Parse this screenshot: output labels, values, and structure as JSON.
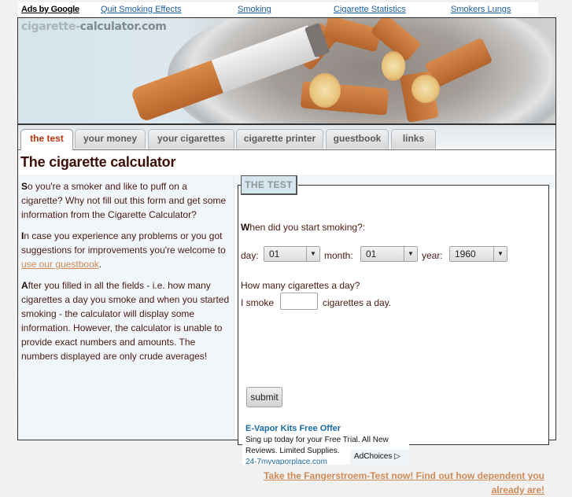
{
  "adbar": {
    "ads_by": "Ads by Google",
    "links": [
      "Quit Smoking Effects",
      "Smoking",
      "Cigarette Statistics",
      "Smokers Lungs"
    ]
  },
  "header": {
    "logo_part1": "cigarette-",
    "logo_part2": "calculator.com"
  },
  "tabs": [
    {
      "label": "the test",
      "active": true
    },
    {
      "label": "your money",
      "active": false
    },
    {
      "label": "your cigarettes",
      "active": false
    },
    {
      "label": "cigarette printer",
      "active": false
    },
    {
      "label": "guestbook",
      "active": false
    },
    {
      "label": "links",
      "active": false
    }
  ],
  "page_title": "The cigarette calculator",
  "intro": {
    "p1_initial": "S",
    "p1_rest": "o you're a smoker and like to puff on a cigarette? Why not fill out this form and get some information from the Cigarette Calculator?",
    "p2_initial": "I",
    "p2_rest": "n case you experience any problems or you got suggestions for improvements you're welcome to ",
    "p2_link": "use our guestbook",
    "p2_end": ".",
    "p3_initial": "A",
    "p3_rest": "fter you filled in all the fields - i.e. how many cigarettes a day you smoke and when you started smoking - the calculator will display some information. However, the calculator is unable to provide exact numbers and amounts. The numbers displayed are only crude averages!"
  },
  "form": {
    "legend": "THE TEST",
    "q1_initial": "W",
    "q1_rest": "hen did you start smoking?:",
    "day_label": "day:",
    "day_value": "01",
    "month_label": "month:",
    "month_value": "01",
    "year_label": "year:",
    "year_value": "1960",
    "q2": "How many cigarettes a day?",
    "smoke_prefix": "I smoke",
    "smoke_value": "",
    "smoke_suffix": "cigarettes a day.",
    "submit_label": "submit"
  },
  "ad": {
    "title": "E-Vapor Kits Free Offer",
    "body": "Sing up today for your Free Trial. All New Reviews. Limited Supplies.",
    "url": "24-7myvaporplace.com",
    "adchoices": "AdChoices"
  },
  "fangerstroem_link": "Take the Fangerstroem-Test now! Find out how dependent you already are!"
}
